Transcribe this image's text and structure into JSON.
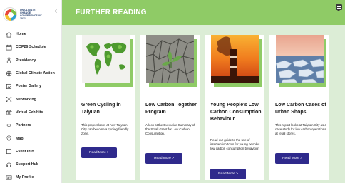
{
  "sidebar": {
    "logo_text": "UN CLIMATE CHANGE CONFERENCE UK 2021",
    "collapse_icon": "chevron-left-icon",
    "items": [
      {
        "label": "Home",
        "icon": "home-icon"
      },
      {
        "label": "COP26 Schedule",
        "icon": "calendar-icon"
      },
      {
        "label": "Presidency",
        "icon": "person-icon"
      },
      {
        "label": "Global Climate Action",
        "icon": "globe-icon"
      },
      {
        "label": "Poster Gallery",
        "icon": "poster-icon"
      },
      {
        "label": "Networking",
        "icon": "network-icon"
      },
      {
        "label": "Virtual Exhibits",
        "icon": "exhibit-icon"
      },
      {
        "label": "Partners",
        "icon": "handshake-icon"
      },
      {
        "label": "Map",
        "icon": "map-icon"
      },
      {
        "label": "Event Info",
        "icon": "info-icon"
      },
      {
        "label": "Support Hub",
        "icon": "support-icon"
      },
      {
        "label": "My Profile",
        "icon": "profile-icon"
      }
    ]
  },
  "header": {
    "title": "FURTHER READING",
    "chat_icon": "chat-icon"
  },
  "colors": {
    "header": "#8fcb66",
    "background": "#dcedd6",
    "button": "#2f2a8c"
  },
  "cards": [
    {
      "image": "green-world-map-image",
      "title": "Green Cycling in Taiyuan",
      "description": "This project looks at how Taiyuan City can become a cycling friendly zone.",
      "button": "Read More >"
    },
    {
      "image": "plant-in-cracked-earth-image",
      "title": "Low Carbon Together Program",
      "description": "A look at the Executive Summary of the Small Grant for Low Carbon Consumption.",
      "button": "Read More >"
    },
    {
      "image": "smokestack-sunset-image",
      "title": "Young People's Low Carbon Consumption Behaviour",
      "description": "Read our guide to the use of intervention tools for young peoples low carbon consumption behaviour.",
      "button": "Read More >"
    },
    {
      "image": "melting-ice-image",
      "title": "Low Carbon Cases of Urban Shops",
      "description": "This report looks at Taiyuan City as a case study for low carbon operations at retail stores.",
      "button": "Read More >"
    }
  ]
}
